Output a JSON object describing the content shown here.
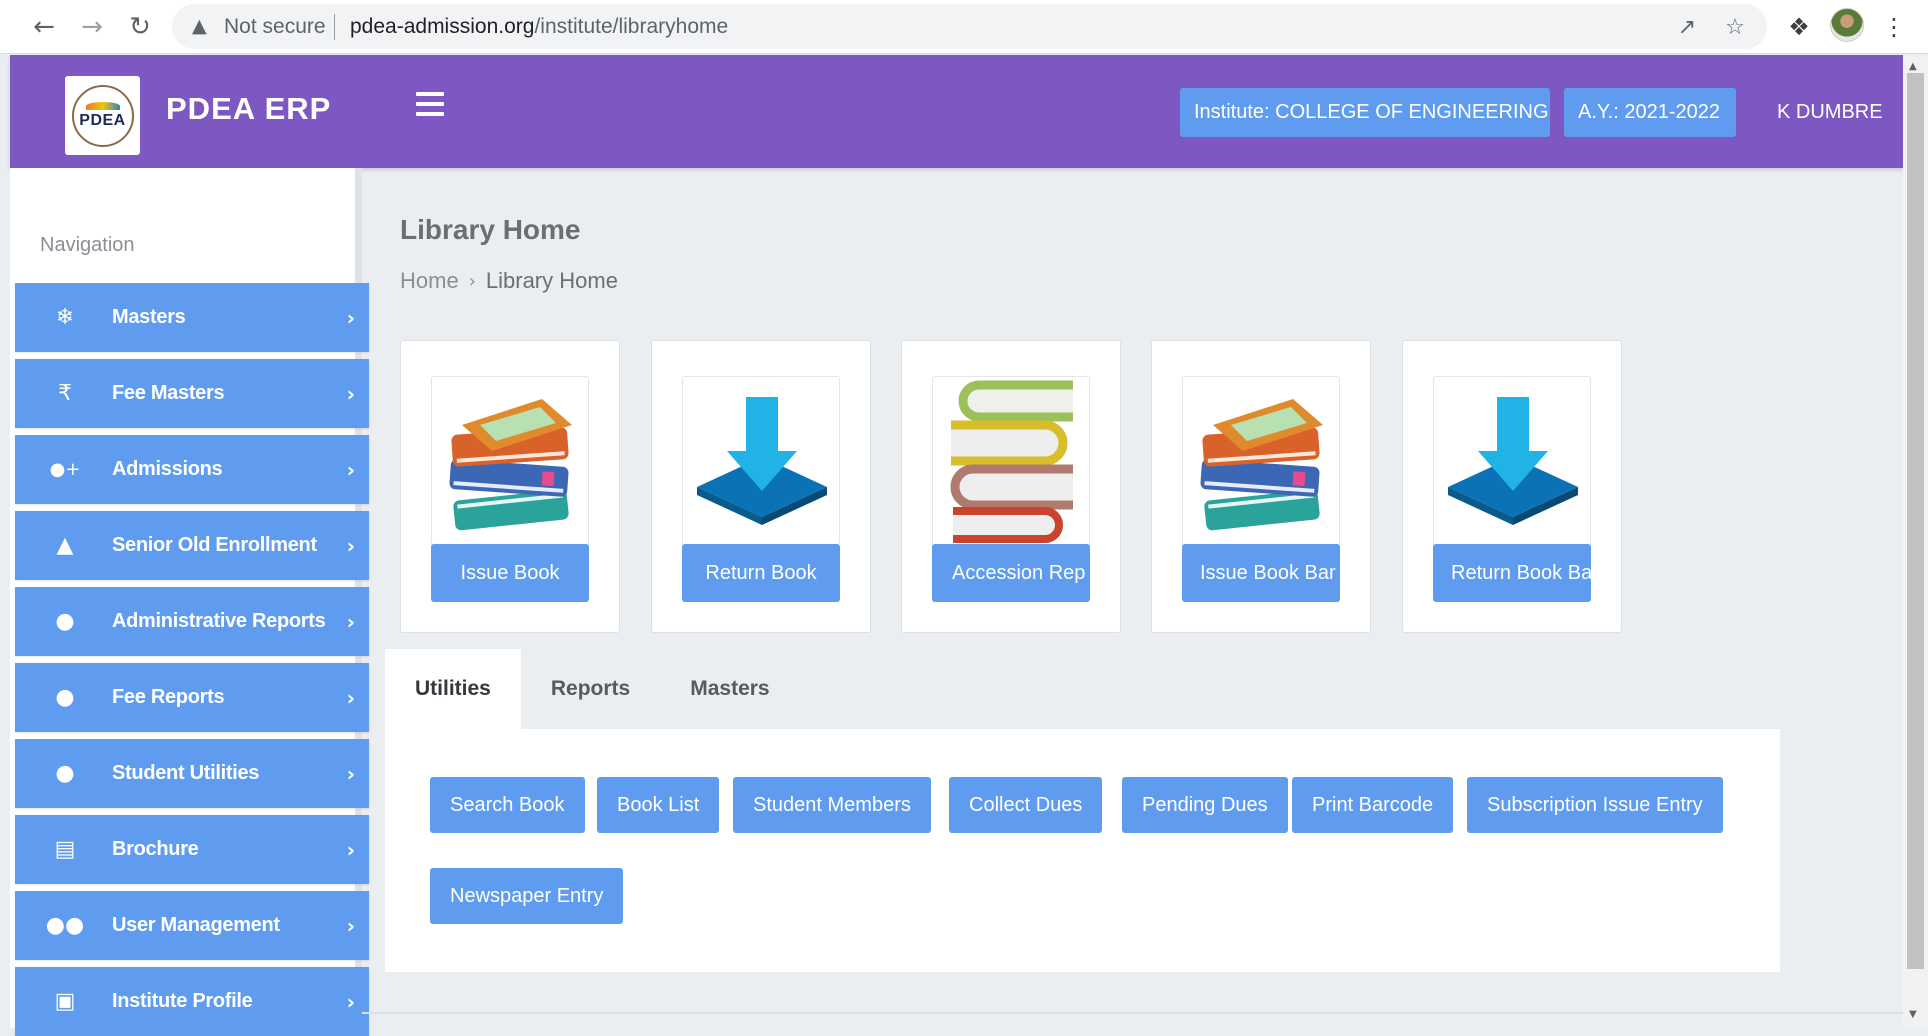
{
  "browser": {
    "not_secure": "Not secure",
    "url_host": "pdea-admission.org",
    "url_path": "/institute/libraryhome"
  },
  "header": {
    "brand": "PDEA ERP",
    "logo_text": "PDEA",
    "institute": "Institute: COLLEGE OF ENGINEERING",
    "academic_year": "A.Y.: 2021-2022",
    "user": "K DUMBRE"
  },
  "sidebar": {
    "heading": "Navigation",
    "items": [
      {
        "label": "Masters",
        "icon": "snowflake-icon"
      },
      {
        "label": "Fee Masters",
        "icon": "rupee-icon"
      },
      {
        "label": "Admissions",
        "icon": "user-plus-icon"
      },
      {
        "label": "Senior Old Enrollment",
        "icon": "graduation-cap-icon"
      },
      {
        "label": "Administrative Reports",
        "icon": "alert-circle-icon"
      },
      {
        "label": "Fee Reports",
        "icon": "alert-circle-icon"
      },
      {
        "label": "Student Utilities",
        "icon": "alert-circle-icon"
      },
      {
        "label": "Brochure",
        "icon": "book-list-icon"
      },
      {
        "label": "User Management",
        "icon": "users-icon"
      },
      {
        "label": "Institute Profile",
        "icon": "id-card-icon"
      }
    ]
  },
  "page": {
    "title": "Library Home",
    "breadcrumb": [
      "Home",
      "Library Home"
    ]
  },
  "cards": [
    {
      "label": "Issue Book",
      "icon": "book-stack-icon"
    },
    {
      "label": "Return Book",
      "icon": "download-arrow-icon"
    },
    {
      "label": "Accession Rep",
      "icon": "books-spines-icon"
    },
    {
      "label": "Issue Book Bar",
      "icon": "book-stack-icon"
    },
    {
      "label": "Return Book Ba",
      "icon": "download-arrow-icon"
    }
  ],
  "tabs": [
    "Utilities",
    "Reports",
    "Masters"
  ],
  "utilities": [
    "Search Book",
    "Book List",
    "Student Members",
    "Collect Dues",
    "Pending Dues",
    "Print Barcode",
    "Subscription Issue Entry",
    "Newspaper Entry"
  ],
  "colors": {
    "header": "#7e58c2",
    "accent_blue": "#5f9cf0",
    "background": "#ebeef1"
  }
}
